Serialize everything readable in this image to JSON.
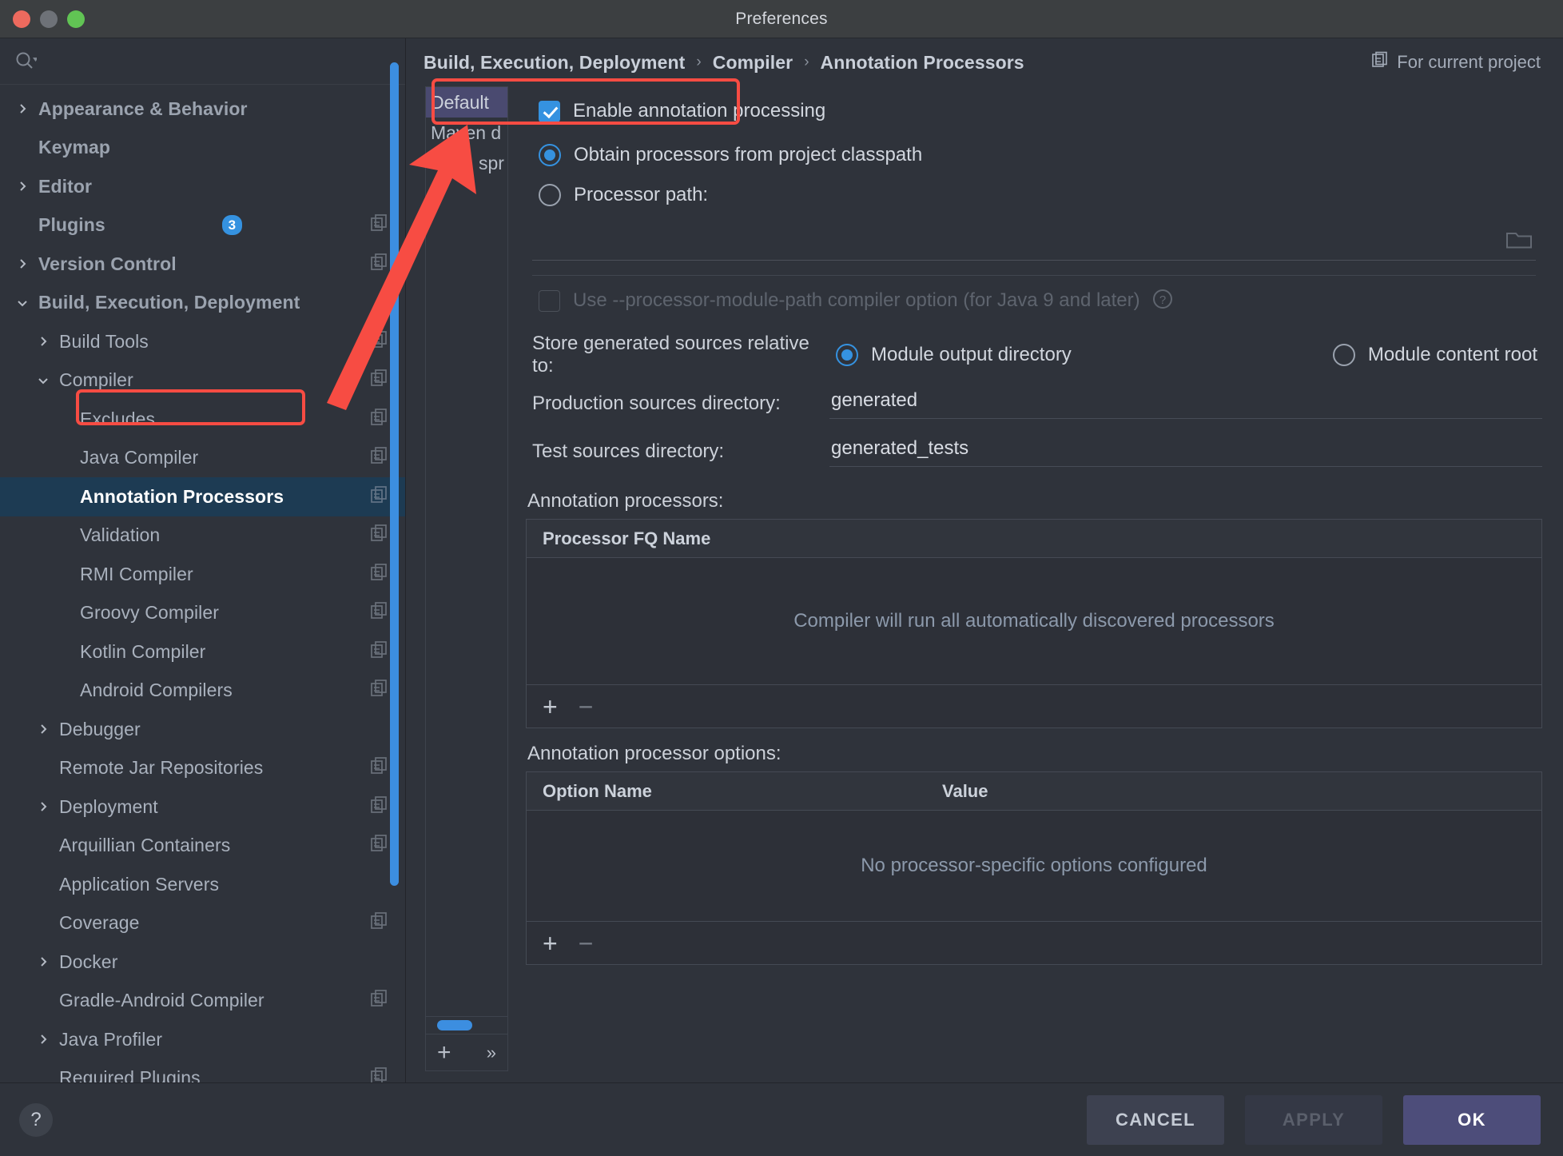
{
  "window": {
    "title": "Preferences",
    "traffic_lights": [
      "close-red",
      "minimize-gray",
      "zoom-green"
    ]
  },
  "sidebar": {
    "search_placeholder": "",
    "items": [
      {
        "label": "Appearance & Behavior",
        "arrow": "›",
        "bold": true,
        "indent": 0,
        "copy": false,
        "badge": null,
        "selected": false
      },
      {
        "label": "Keymap",
        "arrow": "",
        "bold": true,
        "indent": 0,
        "copy": false,
        "badge": null,
        "selected": false
      },
      {
        "label": "Editor",
        "arrow": "›",
        "bold": true,
        "indent": 0,
        "copy": false,
        "badge": null,
        "selected": false
      },
      {
        "label": "Plugins",
        "arrow": "",
        "bold": true,
        "indent": 0,
        "copy": true,
        "badge": "3",
        "selected": false
      },
      {
        "label": "Version Control",
        "arrow": "›",
        "bold": true,
        "indent": 0,
        "copy": true,
        "badge": null,
        "selected": false
      },
      {
        "label": "Build, Execution, Deployment",
        "arrow": "⌄",
        "bold": true,
        "indent": 0,
        "copy": false,
        "badge": null,
        "selected": false
      },
      {
        "label": "Build Tools",
        "arrow": "›",
        "bold": false,
        "indent": 1,
        "copy": true,
        "badge": null,
        "selected": false
      },
      {
        "label": "Compiler",
        "arrow": "⌄",
        "bold": false,
        "indent": 1,
        "copy": true,
        "badge": null,
        "selected": false
      },
      {
        "label": "Excludes",
        "arrow": "",
        "bold": false,
        "indent": 2,
        "copy": true,
        "badge": null,
        "selected": false
      },
      {
        "label": "Java Compiler",
        "arrow": "",
        "bold": false,
        "indent": 2,
        "copy": true,
        "badge": null,
        "selected": false
      },
      {
        "label": "Annotation Processors",
        "arrow": "",
        "bold": false,
        "indent": 2,
        "copy": true,
        "badge": null,
        "selected": true
      },
      {
        "label": "Validation",
        "arrow": "",
        "bold": false,
        "indent": 2,
        "copy": true,
        "badge": null,
        "selected": false
      },
      {
        "label": "RMI Compiler",
        "arrow": "",
        "bold": false,
        "indent": 2,
        "copy": true,
        "badge": null,
        "selected": false
      },
      {
        "label": "Groovy Compiler",
        "arrow": "",
        "bold": false,
        "indent": 2,
        "copy": true,
        "badge": null,
        "selected": false
      },
      {
        "label": "Kotlin Compiler",
        "arrow": "",
        "bold": false,
        "indent": 2,
        "copy": true,
        "badge": null,
        "selected": false
      },
      {
        "label": "Android Compilers",
        "arrow": "",
        "bold": false,
        "indent": 2,
        "copy": true,
        "badge": null,
        "selected": false
      },
      {
        "label": "Debugger",
        "arrow": "›",
        "bold": false,
        "indent": 1,
        "copy": false,
        "badge": null,
        "selected": false
      },
      {
        "label": "Remote Jar Repositories",
        "arrow": "",
        "bold": false,
        "indent": 1,
        "copy": true,
        "badge": null,
        "selected": false
      },
      {
        "label": "Deployment",
        "arrow": "›",
        "bold": false,
        "indent": 1,
        "copy": true,
        "badge": null,
        "selected": false
      },
      {
        "label": "Arquillian Containers",
        "arrow": "",
        "bold": false,
        "indent": 1,
        "copy": true,
        "badge": null,
        "selected": false
      },
      {
        "label": "Application Servers",
        "arrow": "",
        "bold": false,
        "indent": 1,
        "copy": false,
        "badge": null,
        "selected": false
      },
      {
        "label": "Coverage",
        "arrow": "",
        "bold": false,
        "indent": 1,
        "copy": true,
        "badge": null,
        "selected": false
      },
      {
        "label": "Docker",
        "arrow": "›",
        "bold": false,
        "indent": 1,
        "copy": false,
        "badge": null,
        "selected": false
      },
      {
        "label": "Gradle-Android Compiler",
        "arrow": "",
        "bold": false,
        "indent": 1,
        "copy": true,
        "badge": null,
        "selected": false
      },
      {
        "label": "Java Profiler",
        "arrow": "›",
        "bold": false,
        "indent": 1,
        "copy": false,
        "badge": null,
        "selected": false
      },
      {
        "label": "Required Plugins",
        "arrow": "",
        "bold": false,
        "indent": 1,
        "copy": true,
        "badge": null,
        "selected": false
      }
    ]
  },
  "breadcrumb": {
    "parts": [
      "Build, Execution, Deployment",
      "Compiler",
      "Annotation Processors"
    ],
    "separator": "›",
    "scope_label": "For current project"
  },
  "modules": {
    "rows": [
      {
        "label": "Default",
        "selected": true,
        "folder": false
      },
      {
        "label": "Maven d",
        "selected": false,
        "folder": false
      },
      {
        "label": "spr",
        "selected": false,
        "folder": true
      }
    ],
    "add_label": "+",
    "more_label": "»"
  },
  "settings": {
    "enable_annotation_processing": {
      "label": "Enable annotation processing",
      "checked": true
    },
    "processor_source": {
      "selected": "obtain_classpath",
      "options": [
        {
          "id": "obtain_classpath",
          "label": "Obtain processors from project classpath",
          "selected": true
        },
        {
          "id": "processor_path",
          "label": "Processor path:",
          "selected": false
        }
      ]
    },
    "processor_path_value": "",
    "module_path_option": {
      "label": "Use --processor-module-path compiler option (for Java 9 and later)",
      "checked": false,
      "disabled": true,
      "help": "?"
    },
    "store_relative_to": {
      "label": "Store generated sources relative to:",
      "options": [
        {
          "id": "module_output",
          "label": "Module output directory",
          "selected": true
        },
        {
          "id": "module_content_root",
          "label": "Module content root",
          "selected": false
        }
      ]
    },
    "production_sources": {
      "label": "Production sources directory:",
      "value": "generated"
    },
    "test_sources": {
      "label": "Test sources directory:",
      "value": "generated_tests"
    },
    "processors_table": {
      "title": "Annotation processors:",
      "columns": [
        "Processor FQ Name"
      ],
      "empty_message": "Compiler will run all automatically discovered processors",
      "add_label": "+",
      "remove_label": "−"
    },
    "options_table": {
      "title": "Annotation processor options:",
      "columns": [
        "Option Name",
        "Value"
      ],
      "empty_message": "No processor-specific options configured",
      "add_label": "+",
      "remove_label": "−"
    }
  },
  "footer": {
    "help_label": "?",
    "cancel_label": "CANCEL",
    "apply_label": "APPLY",
    "ok_label": "OK"
  },
  "annotations": {
    "highlight_color": "#f74c43",
    "boxes": [
      "enable-annotation-processing",
      "annotation-processors-tree-item"
    ],
    "arrow": "points from Annotation Processors tree item to the Enable annotation processing checkbox"
  },
  "colors": {
    "accent_blue": "#3592e0",
    "selection_blue": "#1d3b53",
    "ok_button": "#4d4d7a",
    "annotation_red": "#f74c43",
    "background": "#2f333b"
  }
}
